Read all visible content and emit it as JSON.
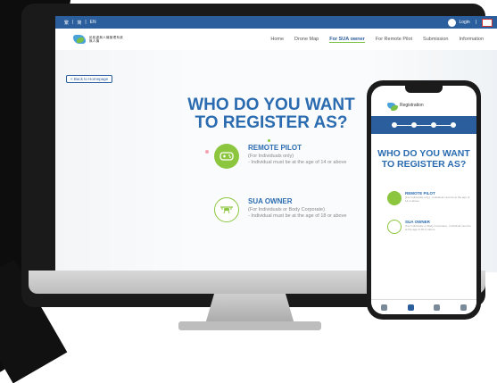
{
  "topbar": {
    "languages": [
      "繁",
      "简",
      "EN"
    ],
    "login_label": "Login"
  },
  "navbar": {
    "logo_lines": [
      "民航處無人機管理系統",
      "無人機"
    ],
    "links": [
      "Home",
      "Drone Map",
      "For SUA owner",
      "For Remote Pilot",
      "Submission",
      "Information"
    ],
    "active_index": 2
  },
  "main": {
    "back_label": "< Back to Homepage",
    "heading_line1": "WHO DO YOU WANT",
    "heading_line2": "TO REGISTER AS?",
    "options": [
      {
        "title": "REMOTE PILOT",
        "sub1": "(For Individuals only)",
        "sub2": "- Individual must be at the age of 14 or above",
        "color": "#8cc63f"
      },
      {
        "title": "SUA OWNER",
        "sub1": "(For Individuals or Body Corporate)",
        "sub2": "- Individual must be at the age of 18 or above",
        "color": "#ffffff"
      }
    ]
  },
  "phone": {
    "header_title": "Registration",
    "heading_line1": "WHO DO YOU WANT",
    "heading_line2": "TO REGISTER AS?",
    "options": [
      {
        "title": "REMOTE PILOT",
        "sub": "(For Individuals only) - Individual must be at the age of 14 or above"
      },
      {
        "title": "SUA OWNER",
        "sub": "(For Individuals or Body Corporate) - Individual must be at the age of 18 or above"
      }
    ]
  },
  "colors": {
    "brand_blue": "#2b5e9c",
    "heading_blue": "#2b6cb0",
    "accent_green": "#8cc63f"
  }
}
